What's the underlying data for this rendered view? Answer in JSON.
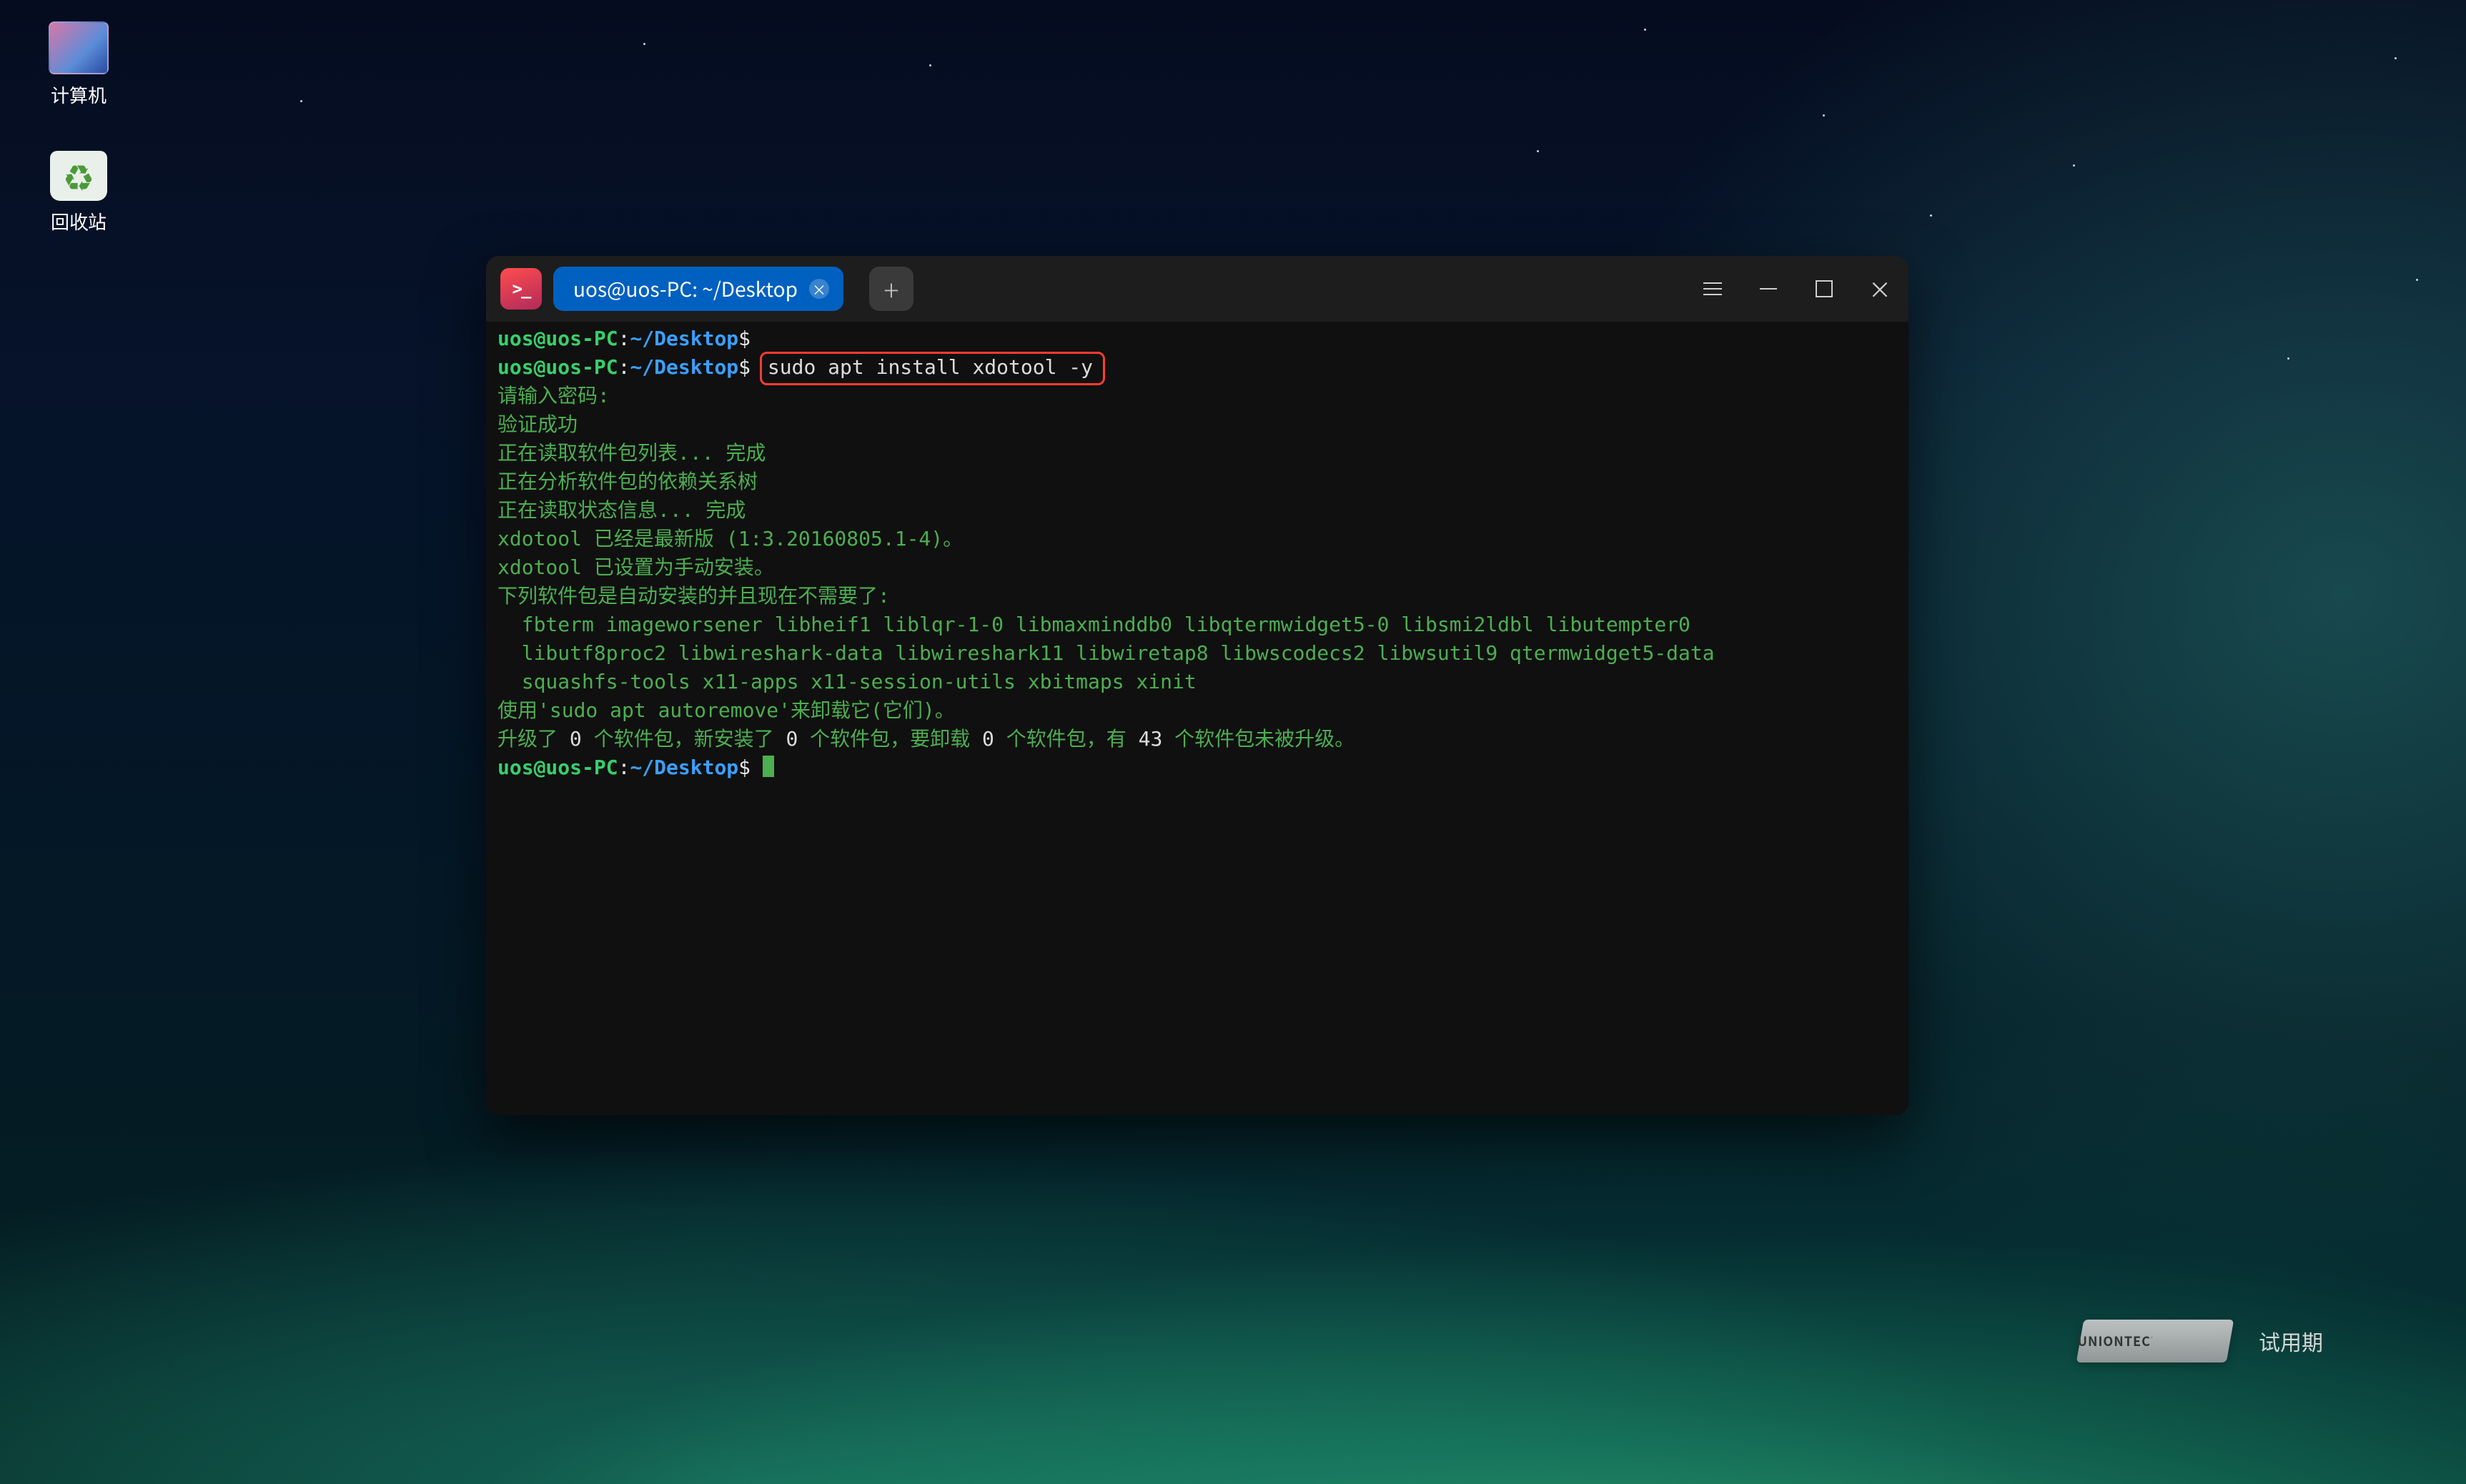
{
  "desktop": {
    "icons": [
      {
        "name": "computer",
        "label": "计算机"
      },
      {
        "name": "trash",
        "label": "回收站"
      }
    ]
  },
  "watermark": {
    "brand": "UNIONTECH",
    "trial": "试用期"
  },
  "terminal": {
    "tab_title": "uos@uos-PC: ~/Desktop",
    "prompt": {
      "user_host": "uos@uos-PC",
      "sep": ":",
      "path": "~/Desktop",
      "symbol": "$"
    },
    "highlighted_command": "sudo apt install xdotool -y",
    "lines": {
      "l1": "请输入密码:",
      "l2": "验证成功",
      "l3": "正在读取软件包列表... 完成",
      "l4": "正在分析软件包的依赖关系树",
      "l5": "正在读取状态信息... 完成",
      "l6": "xdotool 已经是最新版 (1:3.20160805.1-4)。",
      "l7": "xdotool 已设置为手动安装。",
      "l8": "下列软件包是自动安装的并且现在不需要了:",
      "l9": "  fbterm imageworsener libheif1 liblqr-1-0 libmaxminddb0 libqtermwidget5-0 libsmi2ldbl libutempter0",
      "l10": "  libutf8proc2 libwireshark-data libwireshark11 libwiretap8 libwscodecs2 libwsutil9 qtermwidget5-data",
      "l11": "  squashfs-tools x11-apps x11-session-utils xbitmaps xinit",
      "l12": "使用'sudo apt autoremove'来卸载它(它们)。",
      "l13_a": "升级了 ",
      "l13_b": "0",
      "l13_c": " 个软件包，新安装了 ",
      "l13_d": "0",
      "l13_e": " 个软件包，要卸载 ",
      "l13_f": "0",
      "l13_g": " 个软件包，有 ",
      "l13_h": "43",
      "l13_i": " 个软件包未被升级。"
    }
  }
}
